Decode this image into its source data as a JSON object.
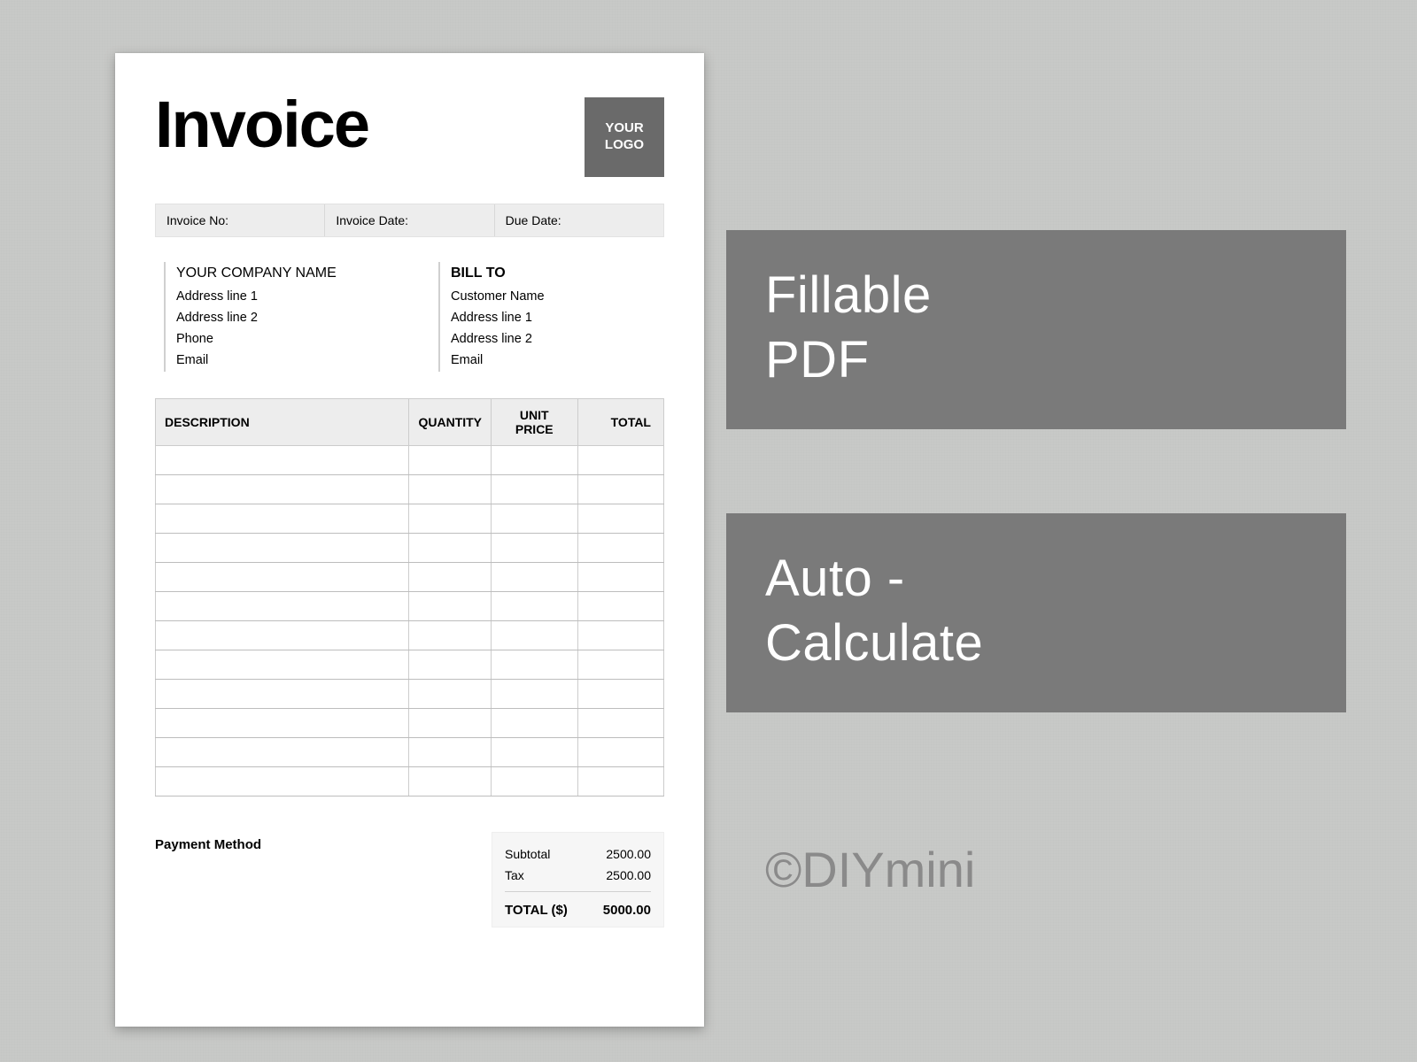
{
  "title": "Invoice",
  "logo": {
    "line1": "YOUR",
    "line2": "LOGO"
  },
  "meta": {
    "invoice_no_label": "Invoice No:",
    "invoice_date_label": "Invoice Date:",
    "due_date_label": "Due Date:"
  },
  "from": {
    "heading": "YOUR COMPANY NAME",
    "line1": "Address line 1",
    "line2": "Address line 2",
    "line3": "Phone",
    "line4": "Email"
  },
  "billto": {
    "heading": "BILL TO",
    "line1": "Customer Name",
    "line2": "Address line 1",
    "line3": "Address line 2",
    "line4": "Email"
  },
  "table": {
    "headers": {
      "description": "DESCRIPTION",
      "quantity": "QUANTITY",
      "unit_price": "UNIT PRICE",
      "total": "TOTAL"
    },
    "row_count": 12
  },
  "payment_method_label": "Payment Method",
  "totals": {
    "subtotal_label": "Subtotal",
    "subtotal_value": "2500.00",
    "tax_label": "Tax",
    "tax_value": "2500.00",
    "total_label": "TOTAL ($)",
    "total_value": "5000.00"
  },
  "badges": {
    "b1_line1": "Fillable",
    "b1_line2": "PDF",
    "b2_line1": "Auto -",
    "b2_line2": "Calculate"
  },
  "brand": "©DIYmini"
}
